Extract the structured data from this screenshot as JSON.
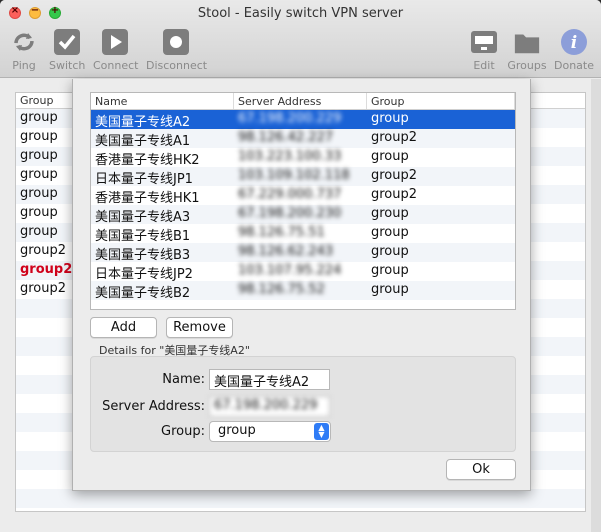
{
  "window": {
    "title": "Stool - Easily switch VPN server"
  },
  "toolbar": {
    "ping": "Ping",
    "switch": "Switch",
    "connect": "Connect",
    "disconnect": "Disconnect",
    "edit": "Edit",
    "groups": "Groups",
    "donate": "Donate"
  },
  "background_table": {
    "header": "Group",
    "rows": [
      "group",
      "group",
      "group",
      "group",
      "group",
      "group",
      "group",
      "group2",
      "group2",
      "group2"
    ]
  },
  "sheet": {
    "columns": {
      "name": "Name",
      "address": "Server Address",
      "group": "Group"
    },
    "servers": [
      {
        "name": "美国量子专线A2",
        "address": "67.198.200.229",
        "group": "group"
      },
      {
        "name": "美国量子专线A1",
        "address": "98.126.42.227",
        "group": "group2"
      },
      {
        "name": "香港量子专线HK2",
        "address": "103.223.100.33",
        "group": "group"
      },
      {
        "name": "日本量子专线JP1",
        "address": "103.109.102.118",
        "group": "group2"
      },
      {
        "name": "香港量子专线HK1",
        "address": "67.229.000.737",
        "group": "group2"
      },
      {
        "name": "美国量子专线A3",
        "address": "67.198.200.230",
        "group": "group"
      },
      {
        "name": "美国量子专线B1",
        "address": "98.126.75.51",
        "group": "group"
      },
      {
        "name": "美国量子专线B3",
        "address": "98.126.62.243",
        "group": "group"
      },
      {
        "name": "日本量子专线JP2",
        "address": "103.107.95.224",
        "group": "group"
      },
      {
        "name": "美国量子专线B2",
        "address": "98.126.75.52",
        "group": "group"
      }
    ],
    "add_label": "Add",
    "remove_label": "Remove",
    "details_title": "Details for \"美国量子专线A2\"",
    "name_label": "Name:",
    "name_value": "美国量子专线A2",
    "address_label": "Server Address:",
    "address_value": "67.198.200.229",
    "group_label": "Group:",
    "group_value": "group",
    "ok_label": "Ok"
  },
  "colors": {
    "selection": "#1a62d6",
    "accent": "#2f7cf6",
    "highlight_group": "#d0021b"
  }
}
